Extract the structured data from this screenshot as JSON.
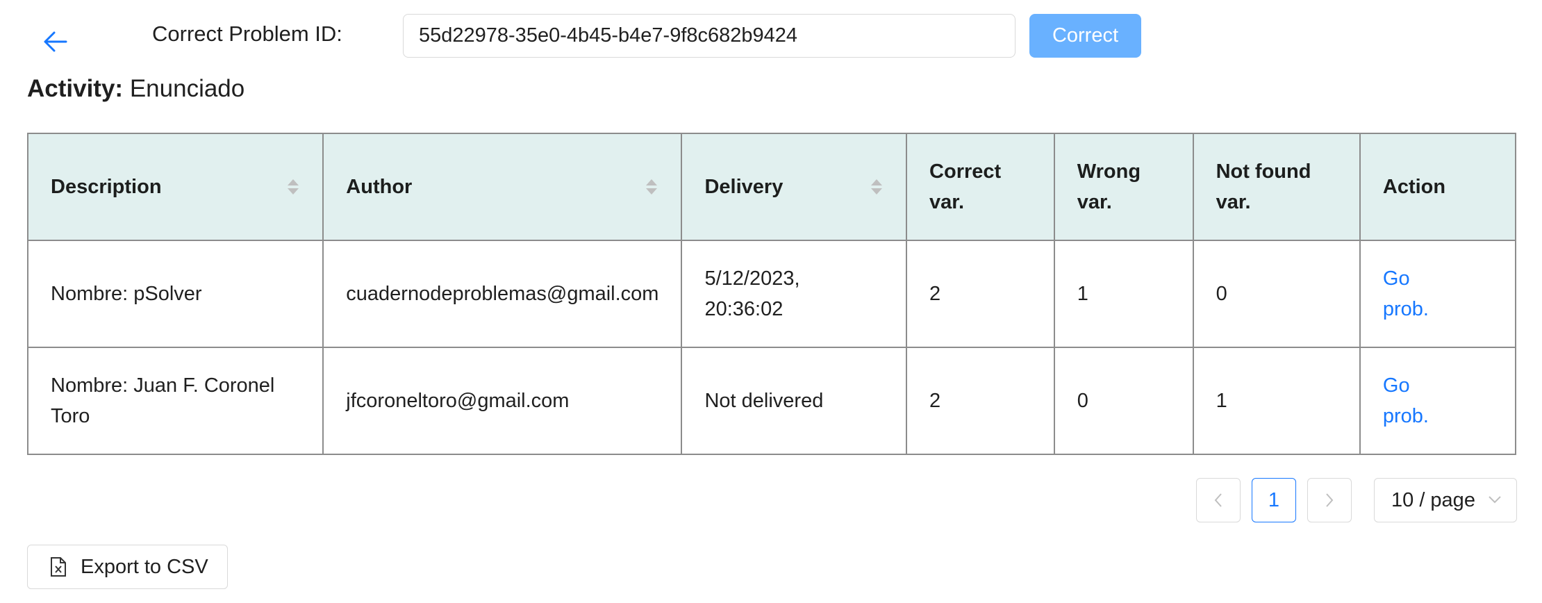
{
  "header": {
    "back_icon": "arrow-left-icon",
    "problem_label": "Correct Problem ID:",
    "problem_id_value": "55d22978-35e0-4b45-b4e7-9f8c682b9424",
    "correct_button": "Correct"
  },
  "activity": {
    "label": "Activity:",
    "value": "Enunciado"
  },
  "table": {
    "columns": {
      "description": "Description",
      "author": "Author",
      "delivery": "Delivery",
      "correct_var_1": "Correct",
      "correct_var_2": "var.",
      "wrong_var_1": "Wrong",
      "wrong_var_2": "var.",
      "notfound_var_1": "Not found",
      "notfound_var_2": "var.",
      "action": "Action"
    },
    "rows": [
      {
        "description": "Nombre: pSolver",
        "author": "cuadernodeproblemas@gmail.com",
        "delivery_1": "5/12/2023,",
        "delivery_2": "20:36:02",
        "correct": "2",
        "wrong": "1",
        "not_found": "0",
        "action_1": "Go",
        "action_2": "prob."
      },
      {
        "description_1": "Nombre: Juan F. Coronel",
        "description_2": "Toro",
        "author": "jfcoroneltoro@gmail.com",
        "delivery": "Not delivered",
        "correct": "2",
        "wrong": "0",
        "not_found": "1",
        "action_1": "Go",
        "action_2": "prob."
      }
    ]
  },
  "pagination": {
    "current_page": "1",
    "page_size": "10 / page"
  },
  "export_button": "Export to CSV",
  "colors": {
    "header_bg": "#e1f0ef",
    "primary_button": "#69b1ff",
    "link": "#1677ff"
  }
}
